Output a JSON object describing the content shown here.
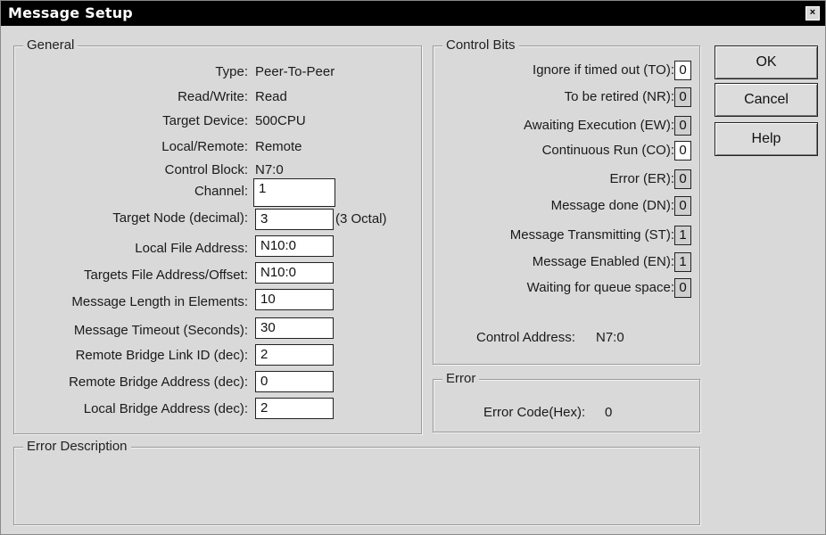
{
  "window": {
    "title": "Message Setup",
    "close_glyph": "×"
  },
  "general": {
    "legend": "General",
    "type": {
      "label": "Type:",
      "value": "Peer-To-Peer"
    },
    "read_write": {
      "label": "Read/Write:",
      "value": "Read"
    },
    "target_device": {
      "label": "Target Device:",
      "value": "500CPU"
    },
    "local_remote": {
      "label": "Local/Remote:",
      "value": "Remote"
    },
    "control_block": {
      "label": "Control Block:",
      "value": "N7:0"
    },
    "channel": {
      "label": "Channel:",
      "value": "1"
    },
    "target_node": {
      "label": "Target Node (decimal):",
      "value": "3",
      "note": "(3 Octal)"
    },
    "local_file_address": {
      "label": "Local File Address:",
      "value": "N10:0"
    },
    "targets_file_address": {
      "label": "Targets File Address/Offset:",
      "value": "N10:0"
    },
    "message_length": {
      "label": "Message Length in Elements:",
      "value": "10"
    },
    "message_timeout": {
      "label": "Message Timeout (Seconds):",
      "value": "30"
    },
    "remote_bridge_link_id": {
      "label": "Remote Bridge Link ID (dec):",
      "value": "2"
    },
    "remote_bridge_address": {
      "label": "Remote Bridge Address (dec):",
      "value": "0"
    },
    "local_bridge_address": {
      "label": "Local Bridge Address (dec):",
      "value": "2"
    }
  },
  "control_bits": {
    "legend": "Control Bits",
    "bits": [
      {
        "label": "Ignore if timed out (TO):",
        "value": "0",
        "editable": true
      },
      {
        "label": "To be retired (NR):",
        "value": "0",
        "editable": false
      },
      {
        "label": "Awaiting Execution (EW):",
        "value": "0",
        "editable": false
      },
      {
        "label": "Continuous Run (CO):",
        "value": "0",
        "editable": true
      },
      {
        "label": "Error (ER):",
        "value": "0",
        "editable": false
      },
      {
        "label": "Message done (DN):",
        "value": "0",
        "editable": false
      },
      {
        "label": "Message Transmitting (ST):",
        "value": "1",
        "editable": false
      },
      {
        "label": "Message Enabled (EN):",
        "value": "1",
        "editable": false
      },
      {
        "label": "Waiting for queue space:",
        "value": "0",
        "editable": false
      }
    ],
    "control_address_label": "Control Address:",
    "control_address_value": "N7:0"
  },
  "error": {
    "legend": "Error",
    "code_label": "Error Code(Hex):",
    "code_value": "0"
  },
  "error_description": {
    "legend": "Error Description",
    "text": ""
  },
  "buttons": {
    "ok": "OK",
    "cancel": "Cancel",
    "help": "Help"
  }
}
